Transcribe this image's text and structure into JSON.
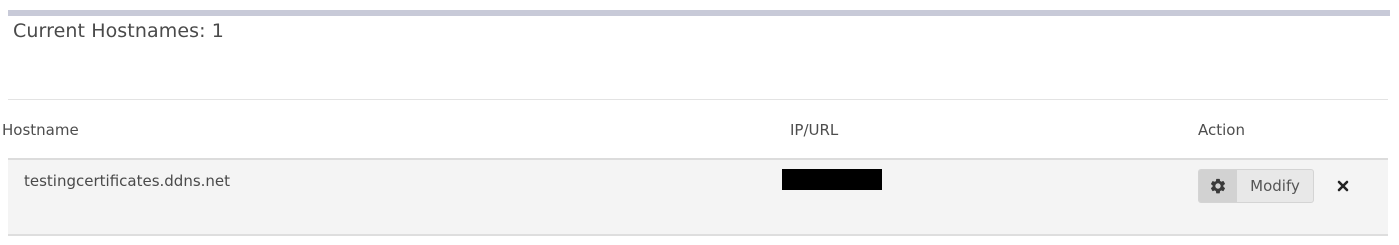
{
  "heading": "Current Hostnames: 1",
  "table": {
    "columns": {
      "hostname": "Hostname",
      "ip_url": "IP/URL",
      "action": "Action"
    },
    "rows": [
      {
        "hostname": "testingcertificates.ddns.net",
        "ip_url": "",
        "modify_label": "Modify"
      }
    ]
  },
  "icons": {
    "modify": "gear-icon",
    "delete": "close-icon"
  },
  "colors": {
    "top_bar": "#c8cad8",
    "row_background": "#f4f4f4",
    "redaction": "#000000"
  }
}
